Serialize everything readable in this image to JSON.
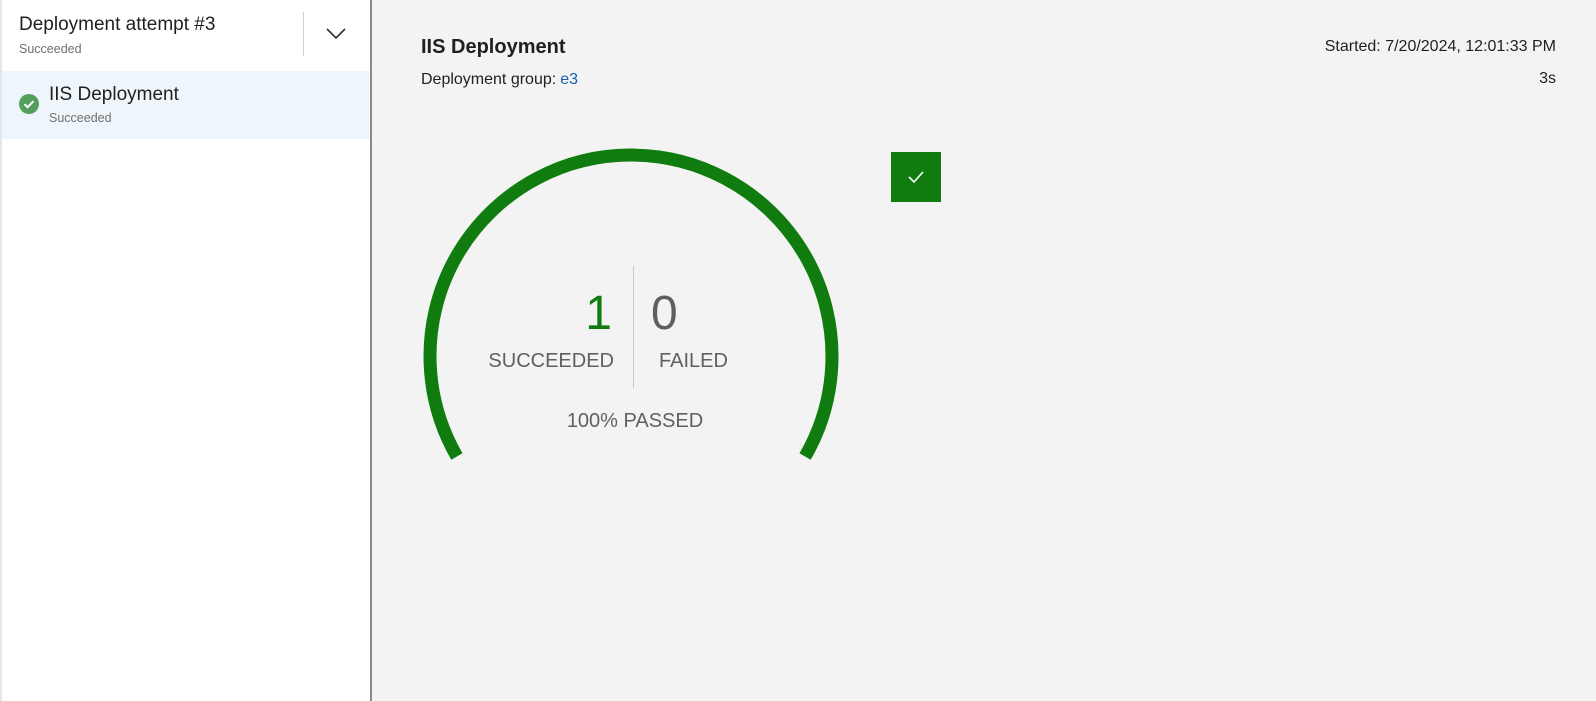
{
  "sidebar": {
    "attempt_title": "Deployment attempt #3",
    "attempt_status": "Succeeded",
    "jobs": [
      {
        "label": "IIS Deployment",
        "status": "Succeeded",
        "icon": "check-circle-icon"
      }
    ]
  },
  "main": {
    "title": "IIS Deployment",
    "group_label": "Deployment group:",
    "group_value": "e3",
    "started": "Started: 7/20/2024, 12:01:33 PM",
    "duration": "3s",
    "summary": {
      "succeeded_count": "1",
      "succeeded_label": "SUCCEEDED",
      "failed_count": "0",
      "failed_label": "FAILED",
      "passed_label": "100% PASSED",
      "passed_fraction": 1.0
    }
  },
  "colors": {
    "success": "#107c10",
    "link": "#1a5fa8",
    "selected_bg": "#eef5fb"
  }
}
